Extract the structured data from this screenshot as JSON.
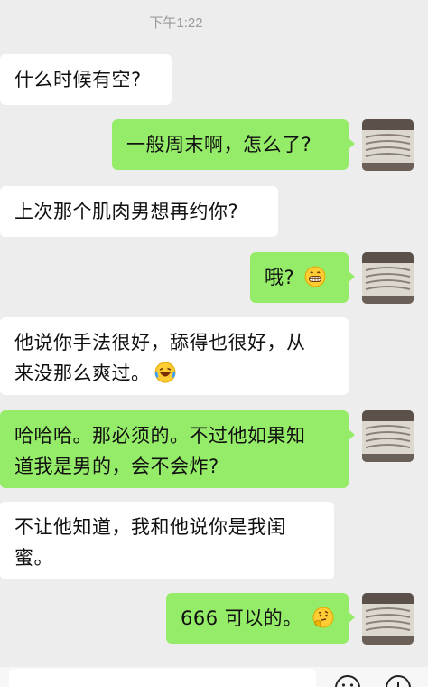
{
  "header": {
    "timestamp": "下午1:22"
  },
  "messages": [
    {
      "side": "in",
      "text": "什么时候有空?"
    },
    {
      "side": "out",
      "text": "一般周末啊，怎么了?"
    },
    {
      "side": "in",
      "text": "上次那个肌肉男想再约你?"
    },
    {
      "side": "out",
      "text": "哦?",
      "emoji": "grinning-face-emoji"
    },
    {
      "side": "in",
      "line1": "他说你手法很好，舔得也很好，从",
      "line2": "来没那么爽过。",
      "emoji": "laughing-crying-face-emoji"
    },
    {
      "side": "out",
      "line1": "哈哈哈。那必须的。不过他如果知",
      "line2": "道我是男的，会不会炸?"
    },
    {
      "side": "in",
      "line1": "不让他知道，我和他说你是我闺",
      "line2": "蜜。"
    },
    {
      "side": "out",
      "text": "666 可以的。",
      "emoji": "thinking-face-emoji"
    }
  ],
  "input_bar": {
    "icons": [
      "emoji-icon",
      "plus-icon"
    ]
  },
  "colors": {
    "background": "#ededed",
    "outgoing_bubble": "#95ec69",
    "incoming_bubble": "#ffffff",
    "timestamp_text": "#9a9a9a"
  }
}
